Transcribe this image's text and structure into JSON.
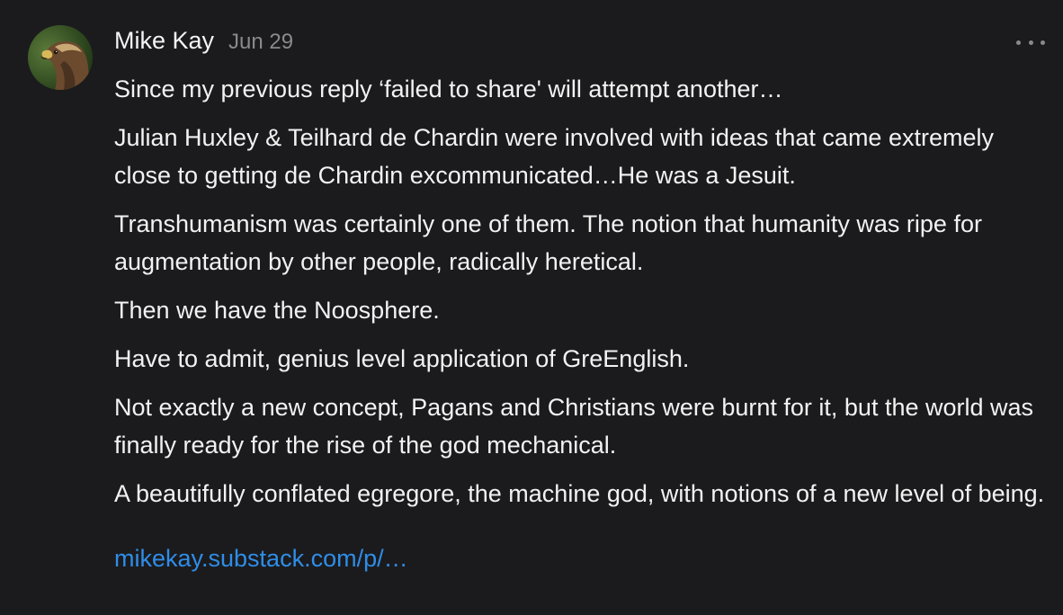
{
  "comment": {
    "author": "Mike Kay",
    "date": "Jun 29",
    "more_icon": "more-horizontal-icon",
    "avatar_icon": "eagle-avatar",
    "paragraphs": [
      "Since my previous reply ‘failed to share' will attempt another…",
      "Julian Huxley & Teilhard de Chardin were involved with ideas that came extremely close to getting de Chardin excommunicated…He was a Jesuit.",
      "Transhumanism was certainly one of them. The notion that humanity was ripe for augmentation by other people, radically heretical.",
      "Then we have the Noosphere.",
      "Have to admit, genius level application of GreEnglish.",
      "Not exactly a new concept, Pagans and Christians were burnt for it, but the world was finally ready for the rise of the god mechanical.",
      "A beautifully conflated egregore, the machine god, with notions of a new level of being."
    ],
    "link_text": "mikekay.substack.com/p/…"
  },
  "colors": {
    "background": "#1b1b1d",
    "text": "#f2f2f2",
    "muted": "#8a8a8e",
    "link": "#2f8de8"
  }
}
